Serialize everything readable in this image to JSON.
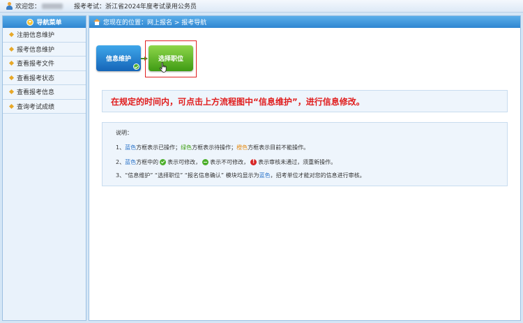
{
  "topbar": {
    "welcome": "欢迎您：",
    "exam_label": "报考考试：浙江省2024年度考试录用公务员"
  },
  "sidebar": {
    "title": "导航菜单",
    "items": [
      {
        "label": "注册信息维护"
      },
      {
        "label": "报考信息维护"
      },
      {
        "label": "查看报考文件"
      },
      {
        "label": "查看报考状态"
      },
      {
        "label": "查看报考信息"
      },
      {
        "label": "查询考试成绩"
      }
    ]
  },
  "breadcrumb": {
    "text": "您现在的位置：网上报名  >  报考导航"
  },
  "flow": {
    "step1": "信息维护",
    "step2": "选择职位"
  },
  "notice": {
    "text": "在规定的时间内，可点击上方流程图中“信息维护”，进行信息修改。"
  },
  "explain": {
    "title": "说明：",
    "l1_num": "1、",
    "l1_blue": "蓝色",
    "l1_t1": "方框表示已操作；",
    "l1_green": "绿色",
    "l1_t2": "方框表示待操作；",
    "l1_orange": "橙色",
    "l1_t3": "方框表示目前不能操作。",
    "l2_num": "2、",
    "l2_blue": "蓝色",
    "l2_t1": "方框中的",
    "l2_t2": "表示可修改，",
    "l2_t3": "表示不可修改，",
    "l2_t4": "表示审核未通过，须重新操作。",
    "l3_num": "3、",
    "l3_t1": "“信息维护” “选择职位” “报名信息确认” 模块均显示为",
    "l3_blue": "蓝色",
    "l3_t2": "，招考单位才能对您的信息进行审核。"
  }
}
